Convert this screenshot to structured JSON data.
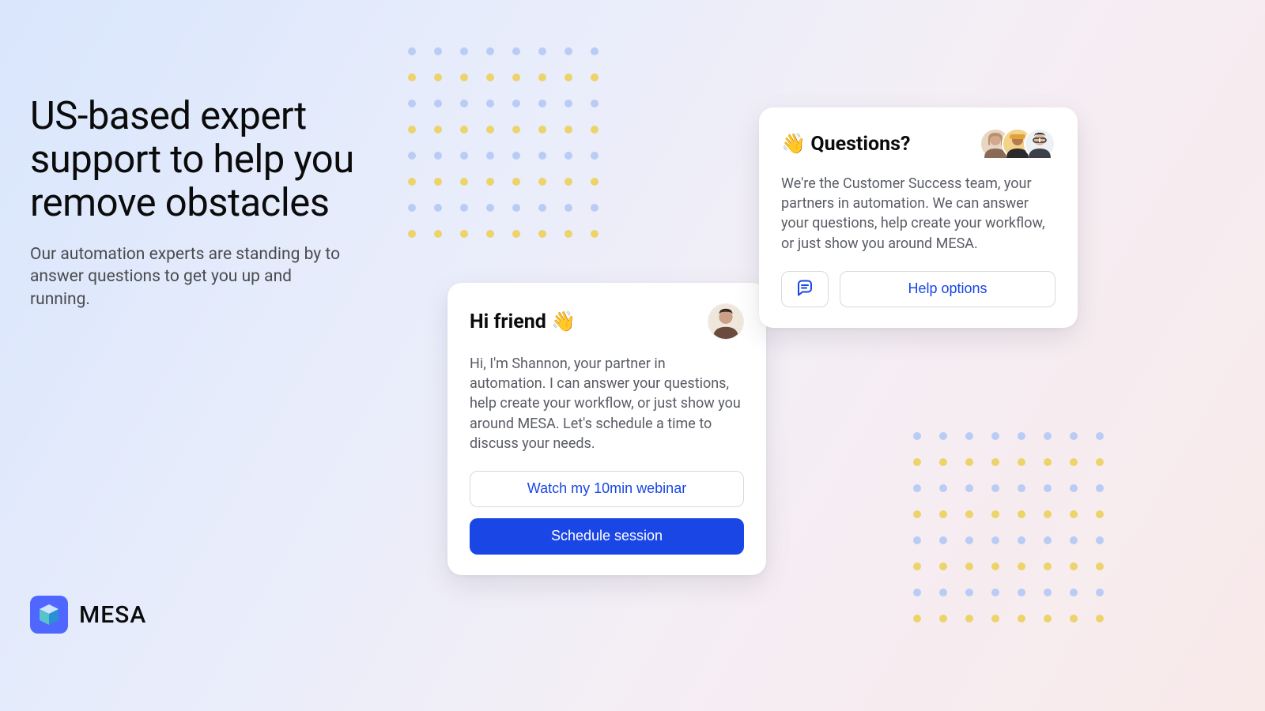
{
  "hero": {
    "headline": "US-based expert support to help you remove obstacles",
    "subtext": "Our automation experts are standing by to answer questions to get you up and running."
  },
  "brand": {
    "name": "MESA"
  },
  "card_hi": {
    "title": "Hi friend 👋",
    "body": "Hi, I'm Shannon, your partner in automation. I can answer your questions, help create your workflow, or just show you around MESA. Let's schedule a time to discuss your needs.",
    "watch_label": "Watch my 10min webinar",
    "schedule_label": "Schedule session"
  },
  "card_questions": {
    "title": "👋 Questions?",
    "body": "We're the Customer Success team, your partners in automation. We can answer your questions, help create your workflow, or just show you around MESA.",
    "help_label": "Help options"
  }
}
